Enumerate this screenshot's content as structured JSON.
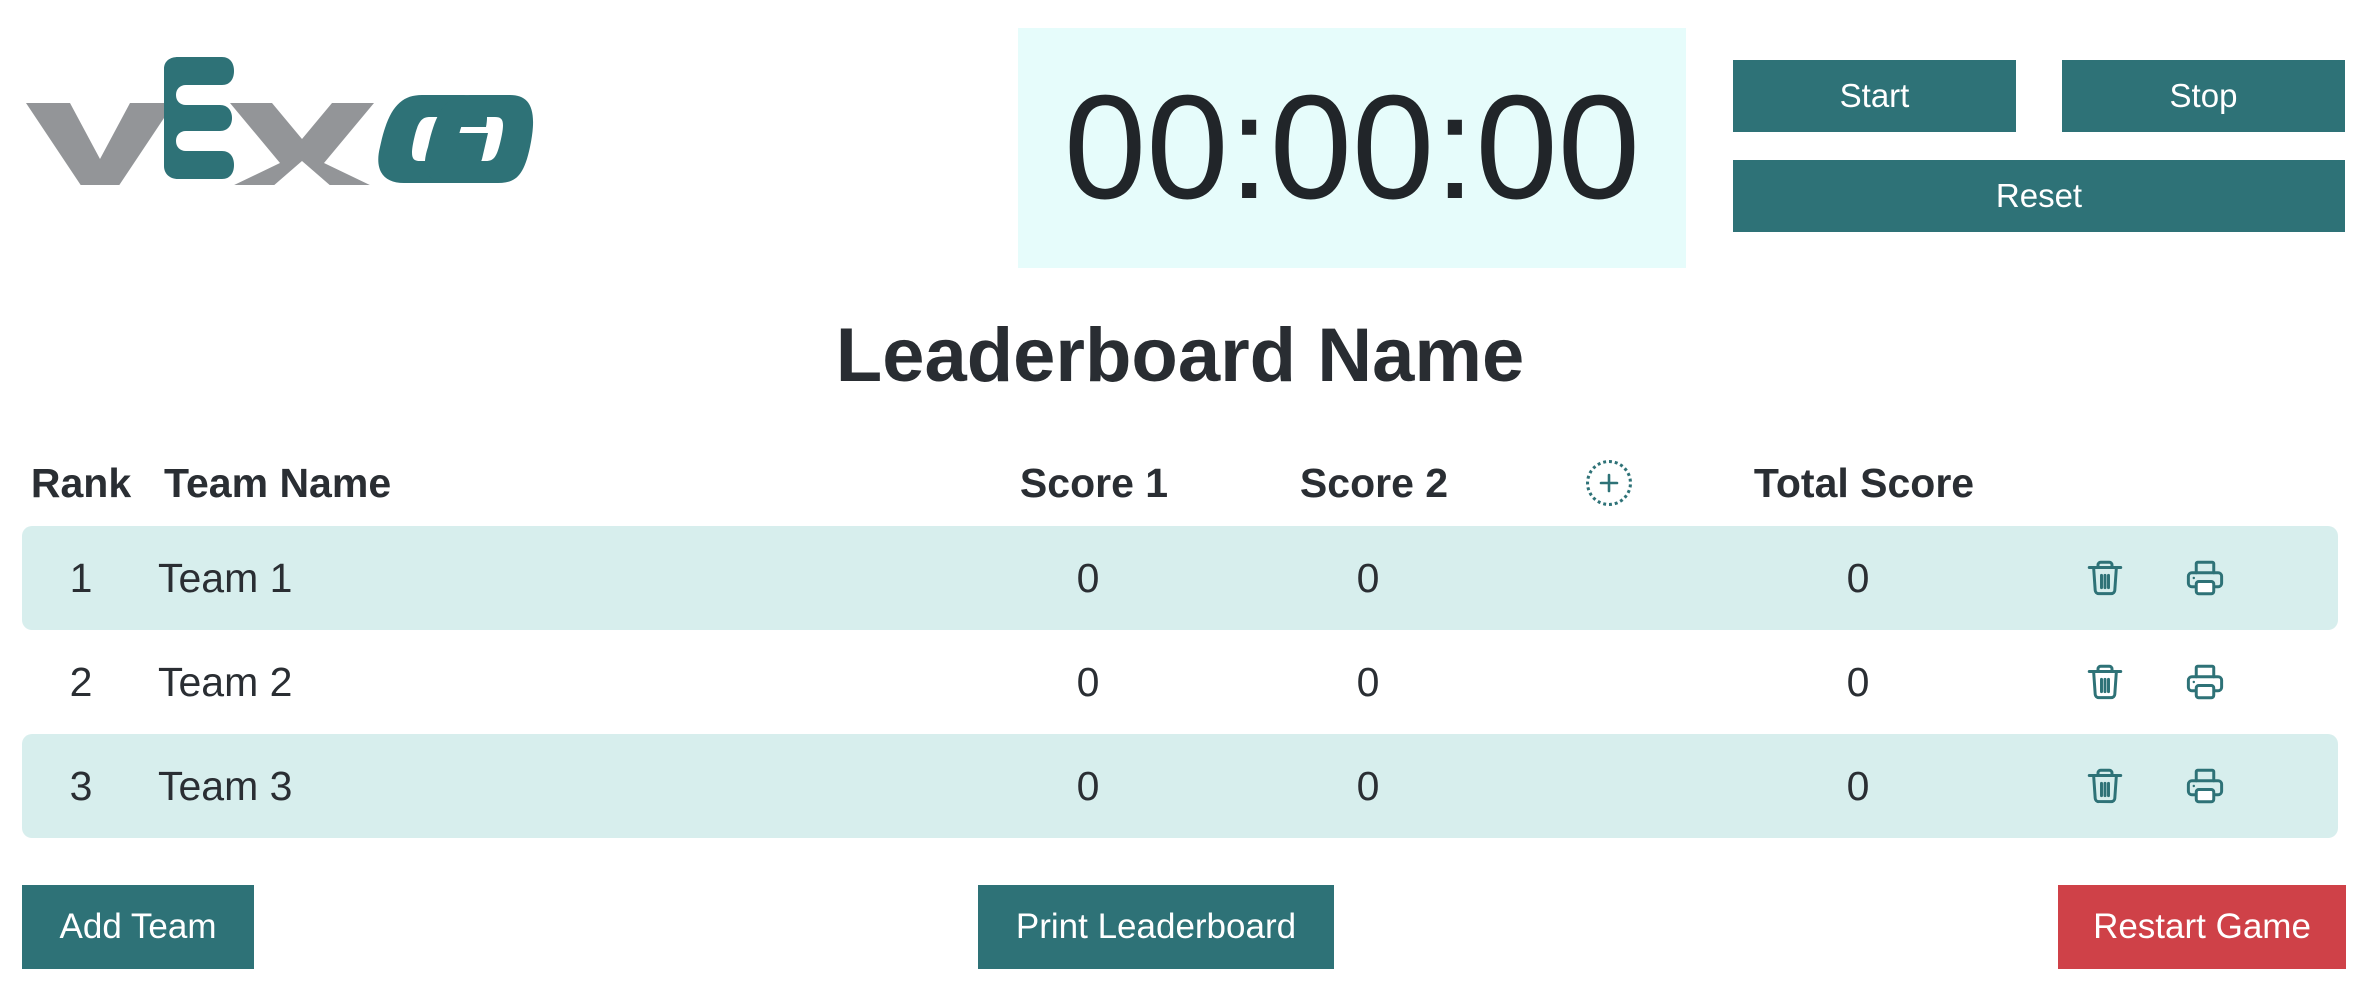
{
  "brand": {
    "logo_text_vex": "VEX",
    "logo_text_go": "GO",
    "logo_name": "vex-go-logo",
    "color_teal": "#2e7277",
    "color_gray": "#939598"
  },
  "timer": {
    "display": "00:00:00",
    "background": "#e6fcfb",
    "buttons": {
      "start": "Start",
      "stop": "Stop",
      "reset": "Reset"
    }
  },
  "leaderboard": {
    "title": "Leaderboard Name",
    "columns": {
      "rank": "Rank",
      "team_name": "Team Name",
      "score_1": "Score 1",
      "score_2": "Score 2",
      "total_score": "Total Score",
      "add_column_icon": "plus-circle-dotted-icon"
    },
    "rows": [
      {
        "rank": "1",
        "team_name": "Team 1",
        "score_1": "0",
        "score_2": "0",
        "total_score": "0",
        "delete_icon": "trash-icon",
        "print_icon": "printer-icon"
      },
      {
        "rank": "2",
        "team_name": "Team 2",
        "score_1": "0",
        "score_2": "0",
        "total_score": "0",
        "delete_icon": "trash-icon",
        "print_icon": "printer-icon"
      },
      {
        "rank": "3",
        "team_name": "Team 3",
        "score_1": "0",
        "score_2": "0",
        "total_score": "0",
        "delete_icon": "trash-icon",
        "print_icon": "printer-icon"
      }
    ],
    "stripe_color": "#d7eeed"
  },
  "footer": {
    "add_team": "Add Team",
    "print_leaderboard": "Print Leaderboard",
    "restart_game": "Restart Game",
    "restart_color": "#cf4148",
    "teal_color": "#2e7277"
  }
}
